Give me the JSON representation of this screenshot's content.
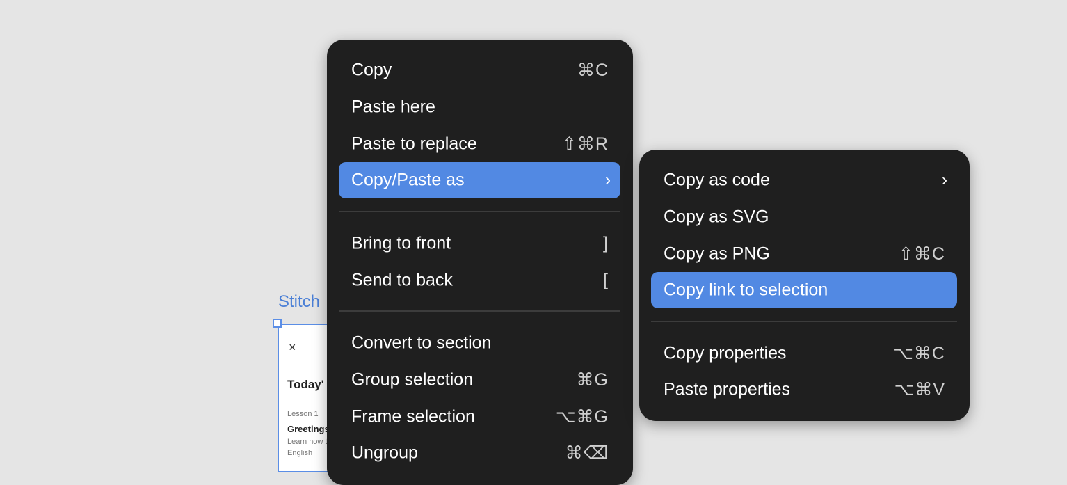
{
  "canvas": {
    "frame_label": "Stitch",
    "frame": {
      "close_glyph": "×",
      "title": "Today'",
      "lesson": "Lesson 1",
      "greeting": "Greetings",
      "learn": "Learn how t",
      "english": "English"
    }
  },
  "main_menu": {
    "items": [
      {
        "label": "Copy",
        "shortcut": "⌘C"
      },
      {
        "label": "Paste here",
        "shortcut": ""
      },
      {
        "label": "Paste to replace",
        "shortcut": "⇧⌘R"
      },
      {
        "label": "Copy/Paste as",
        "submenu_glyph": "›"
      },
      {
        "label": "Bring to front",
        "shortcut": "]"
      },
      {
        "label": "Send to back",
        "shortcut": "["
      },
      {
        "label": "Convert to section",
        "shortcut": ""
      },
      {
        "label": "Group selection",
        "shortcut": "⌘G"
      },
      {
        "label": "Frame selection",
        "shortcut": "⌥⌘G"
      },
      {
        "label": "Ungroup",
        "shortcut": "⌘⌫"
      }
    ]
  },
  "sub_menu": {
    "items": [
      {
        "label": "Copy as code",
        "submenu_glyph": "›"
      },
      {
        "label": "Copy as SVG",
        "shortcut": ""
      },
      {
        "label": "Copy as PNG",
        "shortcut": "⇧⌘C"
      },
      {
        "label": "Copy link to selection",
        "shortcut": ""
      },
      {
        "label": "Copy properties",
        "shortcut": "⌥⌘C"
      },
      {
        "label": "Paste properties",
        "shortcut": "⌥⌘V"
      }
    ]
  },
  "colors": {
    "menu_bg": "#1f1f1f",
    "highlight": "#5289e3",
    "canvas_bg": "#e5e5e5",
    "selection": "#5b8ee6"
  }
}
